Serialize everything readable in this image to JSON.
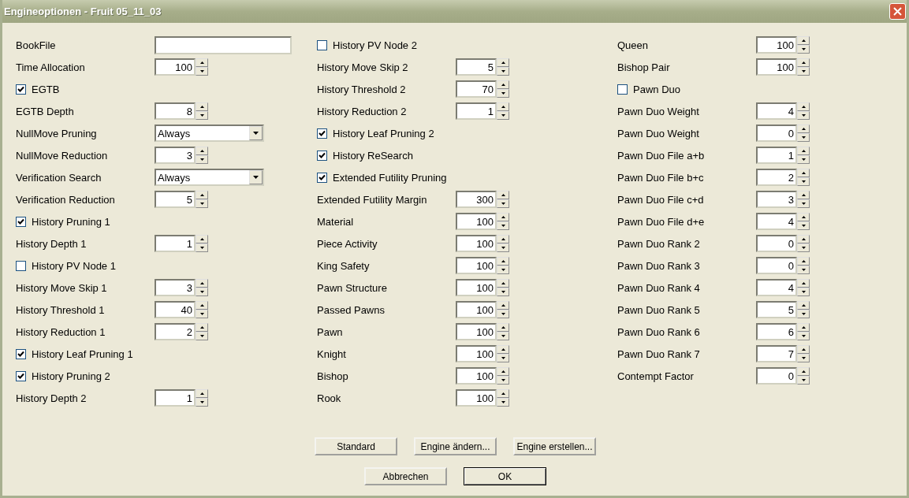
{
  "window": {
    "title": "Engineoptionen - Fruit 05_11_03"
  },
  "columns": [
    [
      {
        "kind": "text",
        "label": "BookFile"
      },
      {
        "kind": "spin",
        "label": "Time Allocation",
        "value": "100"
      },
      {
        "kind": "check",
        "label": "EGTB",
        "checked": true
      },
      {
        "kind": "spin",
        "label": "EGTB Depth",
        "value": "8"
      },
      {
        "kind": "combo",
        "label": "NullMove Pruning",
        "value": "Always"
      },
      {
        "kind": "spin",
        "label": "NullMove Reduction",
        "value": "3"
      },
      {
        "kind": "combo",
        "label": "Verification Search",
        "value": "Always"
      },
      {
        "kind": "spin",
        "label": "Verification Reduction",
        "value": "5"
      },
      {
        "kind": "check",
        "label": "History Pruning 1",
        "checked": true
      },
      {
        "kind": "spin",
        "label": "History Depth 1",
        "value": "1"
      },
      {
        "kind": "check",
        "label": "History PV Node 1",
        "checked": false
      },
      {
        "kind": "spin",
        "label": "History Move Skip 1",
        "value": "3"
      },
      {
        "kind": "spin",
        "label": "History Threshold 1",
        "value": "40"
      },
      {
        "kind": "spin",
        "label": "History Reduction 1",
        "value": "2"
      },
      {
        "kind": "check",
        "label": "History Leaf Pruning 1",
        "checked": true
      },
      {
        "kind": "check",
        "label": "History Pruning 2",
        "checked": true
      },
      {
        "kind": "spin",
        "label": "History Depth 2",
        "value": "1"
      }
    ],
    [
      {
        "kind": "check",
        "label": "History PV Node 2",
        "checked": false
      },
      {
        "kind": "spin",
        "label": "History Move Skip 2",
        "value": "5"
      },
      {
        "kind": "spin",
        "label": "History Threshold 2",
        "value": "70"
      },
      {
        "kind": "spin",
        "label": "History Reduction 2",
        "value": "1"
      },
      {
        "kind": "check",
        "label": "History Leaf Pruning 2",
        "checked": true
      },
      {
        "kind": "check",
        "label": "History ReSearch",
        "checked": true
      },
      {
        "kind": "check",
        "label": "Extended Futility Pruning",
        "checked": true
      },
      {
        "kind": "spin",
        "label": "Extended Futility Margin",
        "value": "300"
      },
      {
        "kind": "spin",
        "label": "Material",
        "value": "100"
      },
      {
        "kind": "spin",
        "label": "Piece Activity",
        "value": "100"
      },
      {
        "kind": "spin",
        "label": "King Safety",
        "value": "100"
      },
      {
        "kind": "spin",
        "label": "Pawn Structure",
        "value": "100"
      },
      {
        "kind": "spin",
        "label": "Passed Pawns",
        "value": "100"
      },
      {
        "kind": "spin",
        "label": "Pawn",
        "value": "100"
      },
      {
        "kind": "spin",
        "label": "Knight",
        "value": "100"
      },
      {
        "kind": "spin",
        "label": "Bishop",
        "value": "100"
      },
      {
        "kind": "spin",
        "label": "Rook",
        "value": "100"
      }
    ],
    [
      {
        "kind": "spin",
        "label": "Queen",
        "value": "100"
      },
      {
        "kind": "spin",
        "label": "Bishop Pair",
        "value": "100"
      },
      {
        "kind": "check",
        "label": "Pawn Duo",
        "checked": false
      },
      {
        "kind": "spin",
        "label": "Pawn Duo Weight",
        "value": "4"
      },
      {
        "kind": "spin",
        "label": "Pawn Duo Weight",
        "value": "0"
      },
      {
        "kind": "spin",
        "label": "Pawn Duo File a+b",
        "value": "1"
      },
      {
        "kind": "spin",
        "label": "Pawn Duo File b+c",
        "value": "2"
      },
      {
        "kind": "spin",
        "label": "Pawn Duo File c+d",
        "value": "3"
      },
      {
        "kind": "spin",
        "label": "Pawn Duo File d+e",
        "value": "4"
      },
      {
        "kind": "spin",
        "label": "Pawn Duo Rank 2",
        "value": "0"
      },
      {
        "kind": "spin",
        "label": "Pawn Duo Rank 3",
        "value": "0"
      },
      {
        "kind": "spin",
        "label": "Pawn Duo Rank 4",
        "value": "4"
      },
      {
        "kind": "spin",
        "label": "Pawn Duo Rank 5",
        "value": "5"
      },
      {
        "kind": "spin",
        "label": "Pawn Duo Rank 6",
        "value": "6"
      },
      {
        "kind": "spin",
        "label": "Pawn Duo Rank 7",
        "value": "7"
      },
      {
        "kind": "spin",
        "label": "Contempt Factor",
        "value": "0"
      }
    ]
  ],
  "button_rows": [
    [
      {
        "label": "Standard",
        "default": false
      },
      {
        "label": "Engine ändern...",
        "default": false
      },
      {
        "label": "Engine erstellen...",
        "default": false
      }
    ],
    [
      {
        "label": "Abbrechen",
        "default": false
      },
      {
        "label": "OK",
        "default": true
      }
    ]
  ]
}
